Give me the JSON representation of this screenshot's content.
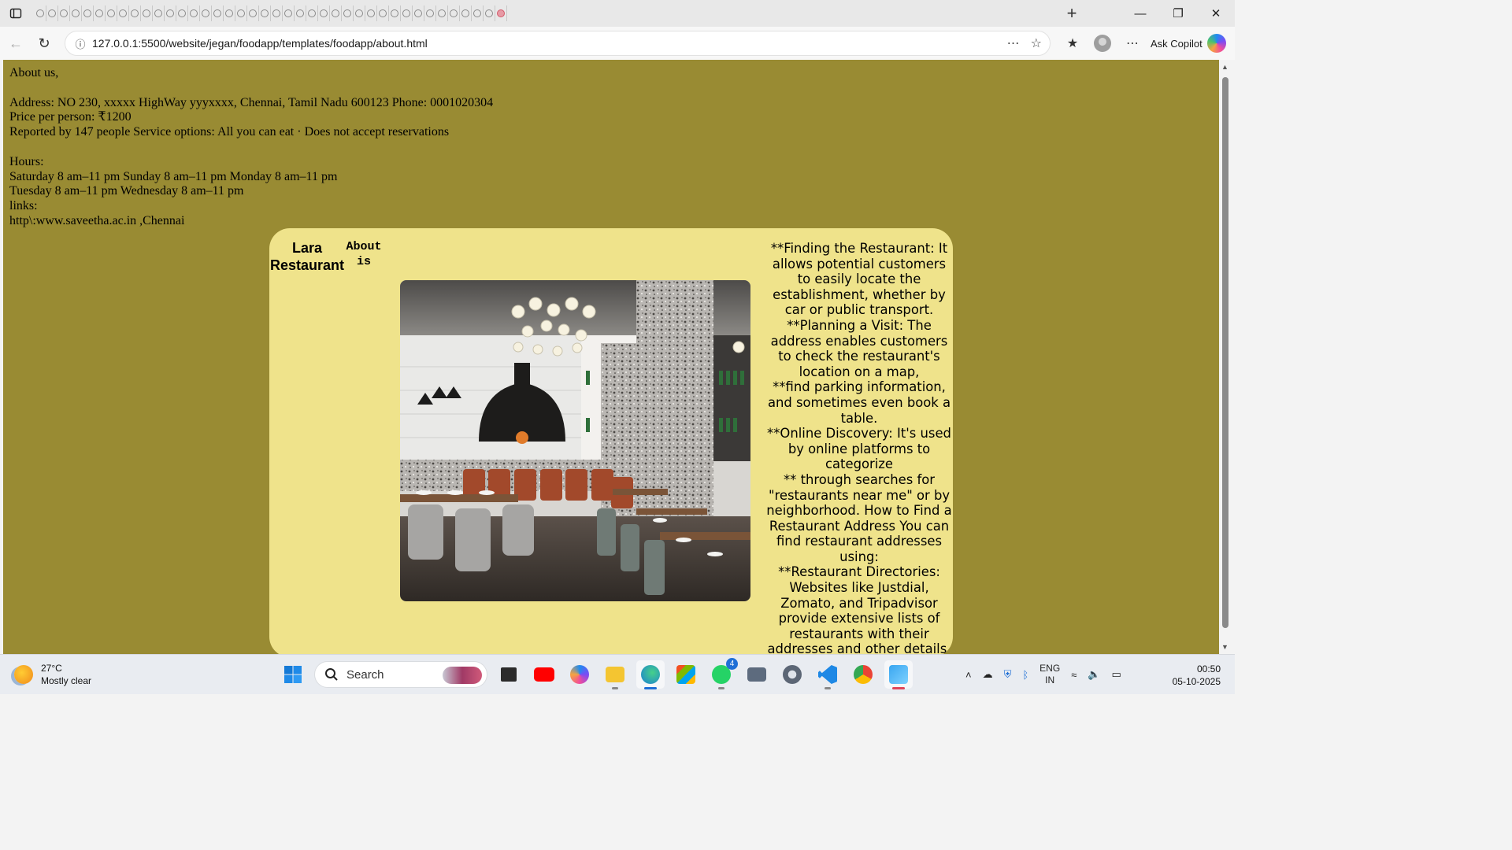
{
  "browser": {
    "url": "127.0.0.1:5500/website/jegan/foodapp/templates/foodapp/about.html",
    "copilot_label": "Ask Copilot",
    "tab_count": 40
  },
  "page": {
    "about_lines": "About us,\n\nAddress: NO 230, xxxxx HighWay yyyxxxx, Chennai, Tamil Nadu 600123 Phone: 0001020304\nPrice per person: ₹1200\nReported by 147 people Service options: All you can eat · Does not accept reservations\n\nHours:\nSaturday 8 am–11 pm Sunday 8 am–11 pm Monday 8 am–11 pm\nTuesday 8 am–11 pm Wednesday 8 am–11 pm\nlinks:\nhttp\\:www.saveetha.ac.in ,Chennai",
    "brand_line1": "Lara",
    "brand_line2": "Restaurant",
    "about_is_line1": "About",
    "about_is_line2": "is",
    "photo_desc": "restaurant-interior",
    "side_text": "**Finding the Restaurant: It allows potential customers to easily locate the establishment, whether by car or public transport.\n**Planning a Visit: The address enables customers to check the restaurant's location on a map,\n**find parking information, and sometimes even book a table.\n**Online Discovery: It's used by online platforms to categorize\n** through searches for \"restaurants near me\" or by neighborhood. How to Find a Restaurant Address You can find restaurant addresses using:\n**Restaurant Directories: Websites like Justdial, Zomato, and Tripadvisor provide extensive lists of restaurants with their addresses and other details.",
    "bg_color": "#998b33",
    "card_color": "#efe38b"
  },
  "taskbar": {
    "weather_temp": "27°C",
    "weather_desc": "Mostly clear",
    "search_placeholder": "Search",
    "whatsapp_badge": "4",
    "lang_line1": "ENG",
    "lang_line2": "IN",
    "time": "00:50",
    "date": "05-10-2025"
  }
}
